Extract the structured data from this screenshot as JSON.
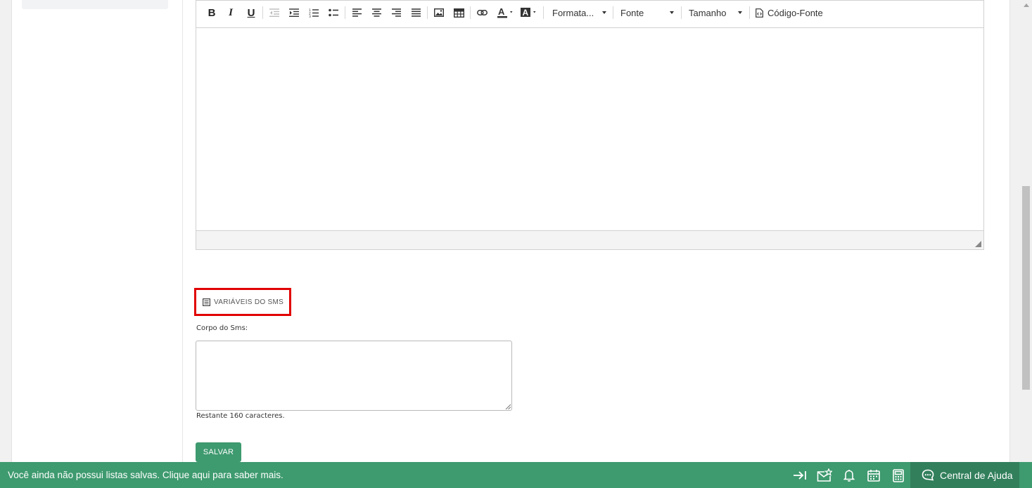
{
  "editor": {
    "toolbar": {
      "buttons": [
        {
          "name": "bold-button",
          "icon": "bold-icon",
          "glyph": "B"
        },
        {
          "name": "italic-button",
          "icon": "italic-icon",
          "glyph": "I"
        },
        {
          "name": "underline-button",
          "icon": "underline-icon",
          "glyph": "U"
        },
        {
          "name": "outdent-button",
          "icon": "outdent-icon"
        },
        {
          "name": "indent-button",
          "icon": "indent-icon"
        },
        {
          "name": "numbered-list-button",
          "icon": "numbered-list-icon"
        },
        {
          "name": "bullet-list-button",
          "icon": "bullet-list-icon"
        },
        {
          "name": "align-left-button",
          "icon": "align-left-icon"
        },
        {
          "name": "align-center-button",
          "icon": "align-center-icon"
        },
        {
          "name": "align-right-button",
          "icon": "align-right-icon"
        },
        {
          "name": "align-justify-button",
          "icon": "align-justify-icon"
        },
        {
          "name": "image-button",
          "icon": "image-icon"
        },
        {
          "name": "table-button",
          "icon": "table-icon"
        },
        {
          "name": "link-button",
          "icon": "link-icon"
        },
        {
          "name": "text-color-button",
          "icon": "text-color-icon"
        },
        {
          "name": "background-color-button",
          "icon": "background-color-icon"
        }
      ],
      "format_label": "Formata...",
      "font_label": "Fonte",
      "size_label": "Tamanho",
      "source_code_label": "Código-Fonte"
    }
  },
  "variables_button_label": "VARIÁVEIS DO SMS",
  "sms_body_label": "Corpo do Sms:",
  "sms_body_value": "",
  "remaining_text": "Restante 160 caracteres.",
  "save_label": "SALVAR",
  "bottom_bar": {
    "message": "Você ainda não possui listas salvas. Clique aqui para saber mais.",
    "icons": [
      "collapse-arrow-icon",
      "mail-star-icon",
      "bell-icon",
      "calendar-icon",
      "calculator-icon"
    ],
    "help_label": "Central de Ajuda"
  },
  "colors": {
    "accent_green": "#3e9a6f",
    "help_green": "#327f5c",
    "highlight_red": "#e10000"
  }
}
